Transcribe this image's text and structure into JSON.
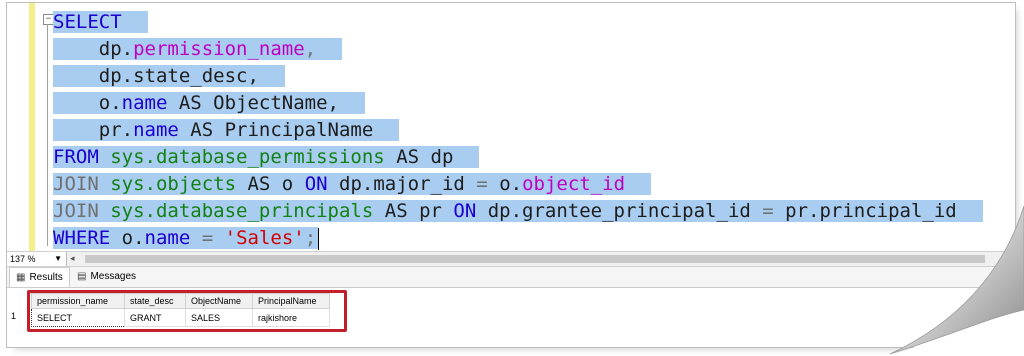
{
  "editor": {
    "lines": [
      [
        "SELECT"
      ],
      [
        "    dp.",
        "permission_name",
        ","
      ],
      [
        "    dp.state_desc,"
      ],
      [
        "    o.",
        "name",
        " AS ObjectName,"
      ],
      [
        "    pr.",
        "name",
        " AS PrincipalName"
      ],
      [
        "FROM ",
        "sys.database_permissions",
        " AS dp"
      ],
      [
        "JOIN ",
        "sys.objects",
        " AS o ",
        "ON",
        " dp.major_id ",
        "=",
        " o.",
        "object_id"
      ],
      [
        "JOIN ",
        "sys.database_principals",
        " AS pr ",
        "ON",
        " dp.grantee_principal_id ",
        "=",
        " pr.principal_id"
      ],
      [
        "WHERE ",
        "o.",
        "name",
        " = ",
        "'Sales'",
        ";"
      ]
    ]
  },
  "status": {
    "zoom": "137 %"
  },
  "tabs": {
    "results": "Results",
    "messages": "Messages"
  },
  "results": {
    "columns": [
      "permission_name",
      "state_desc",
      "ObjectName",
      "PrincipalName"
    ],
    "rows": [
      {
        "num": "1",
        "cells": [
          "SELECT",
          "GRANT",
          "SALES",
          "rajkishore"
        ]
      }
    ]
  },
  "colors": {
    "selection": "#a9cdf0",
    "keyword": "#1c00cf",
    "highlight_box": "#c11f2a"
  }
}
